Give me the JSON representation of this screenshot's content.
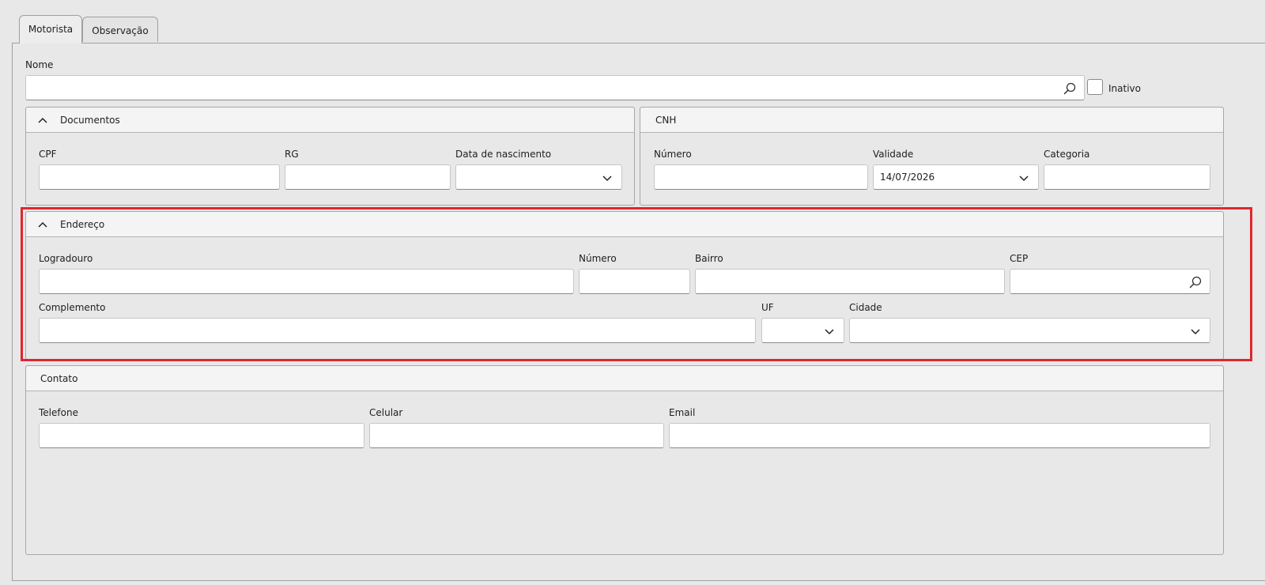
{
  "tabs": [
    {
      "label": "Motorista",
      "active": true
    },
    {
      "label": "Observação",
      "active": false
    }
  ],
  "nome": {
    "label": "Nome",
    "value": "",
    "search_icon": "search-icon"
  },
  "inativo": {
    "label": "Inativo",
    "checked": false
  },
  "documentos": {
    "title": "Documentos",
    "cpf": {
      "label": "CPF",
      "value": ""
    },
    "rg": {
      "label": "RG",
      "value": ""
    },
    "nascimento": {
      "label": "Data de nascimento",
      "value": ""
    }
  },
  "cnh": {
    "title": "CNH",
    "numero": {
      "label": "Número",
      "value": ""
    },
    "validade": {
      "label": "Validade",
      "value": "14/07/2026"
    },
    "categoria": {
      "label": "Categoria",
      "value": ""
    }
  },
  "endereco": {
    "title": "Endereço",
    "logradouro": {
      "label": "Logradouro",
      "value": ""
    },
    "numero": {
      "label": "Número",
      "value": ""
    },
    "bairro": {
      "label": "Bairro",
      "value": ""
    },
    "cep": {
      "label": "CEP",
      "value": ""
    },
    "complemento": {
      "label": "Complemento",
      "value": ""
    },
    "uf": {
      "label": "UF",
      "value": ""
    },
    "cidade": {
      "label": "Cidade",
      "value": ""
    }
  },
  "contato": {
    "title": "Contato",
    "telefone": {
      "label": "Telefone",
      "value": ""
    },
    "celular": {
      "label": "Celular",
      "value": ""
    },
    "email": {
      "label": "Email",
      "value": ""
    }
  },
  "colors": {
    "highlight": "#e0262f",
    "background": "#e8e8e8",
    "panel_header": "#f4f4f4"
  }
}
